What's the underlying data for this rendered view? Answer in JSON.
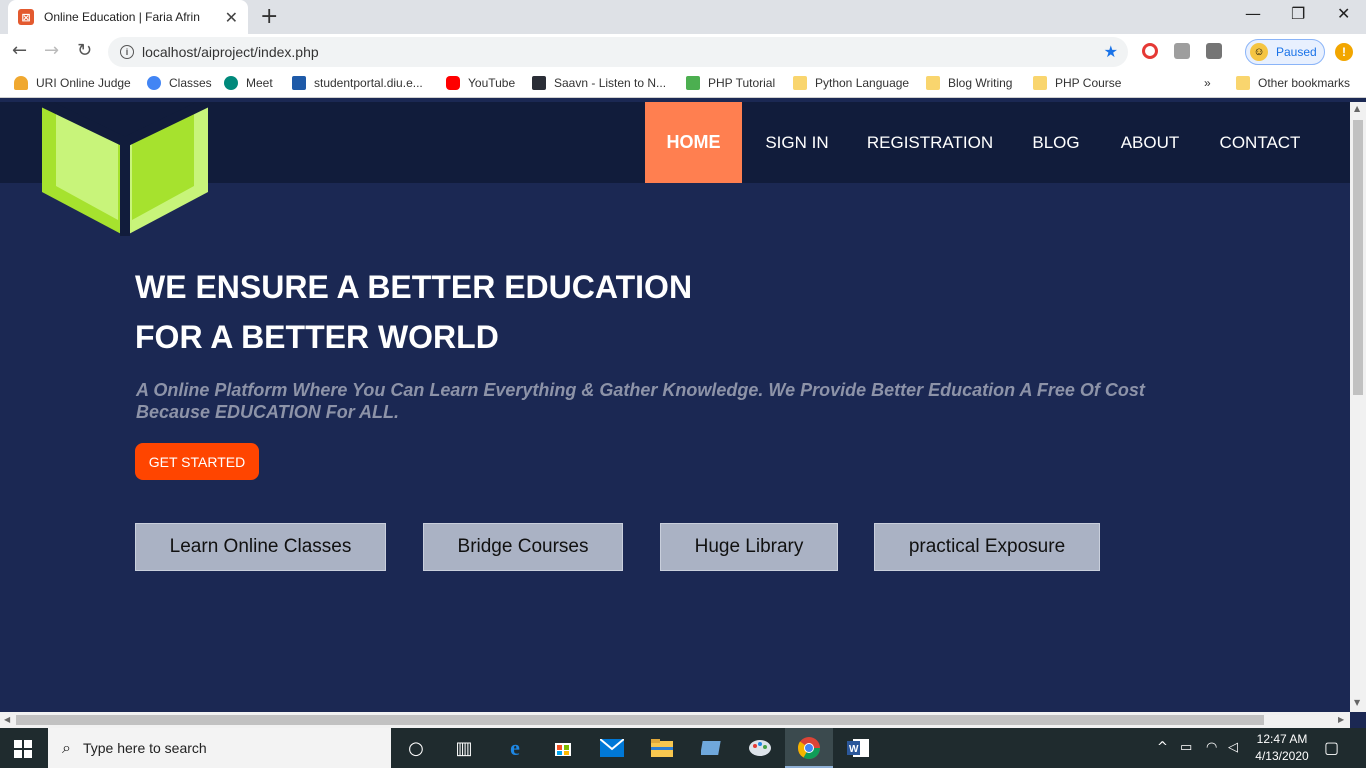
{
  "browser": {
    "tab_title": "Online Education | Faria Afrin",
    "tab_favicon_glyph": "⊠",
    "url_display": "localhost/aiproject/index.php",
    "profile_label": "Paused",
    "bookmarks": [
      {
        "label": "URI Online Judge",
        "icon": "trophy-icon"
      },
      {
        "label": "Classes",
        "icon": "google-icon"
      },
      {
        "label": "Meet",
        "icon": "meet-icon"
      },
      {
        "label": "studentportal.diu.e...",
        "icon": "diu-icon"
      },
      {
        "label": "YouTube",
        "icon": "youtube-icon"
      },
      {
        "label": "Saavn - Listen to N...",
        "icon": "saavn-icon"
      },
      {
        "label": "PHP Tutorial",
        "icon": "w3-icon"
      },
      {
        "label": "Python Language",
        "icon": "folder-icon"
      },
      {
        "label": "Blog Writing",
        "icon": "folder-icon"
      },
      {
        "label": "PHP Course",
        "icon": "folder-icon"
      }
    ],
    "bookmarks_overflow": "»",
    "other_bookmarks": "Other bookmarks"
  },
  "site": {
    "nav": [
      "HOME",
      "SIGN IN",
      "REGISTRATION",
      "BLOG",
      "ABOUT",
      "CONTACT"
    ],
    "active_nav": "HOME",
    "hero_line1": "WE ENSURE A BETTER EDUCATION",
    "hero_line2": "FOR A BETTER WORLD",
    "hero_sub_line1": "A Online Platform Where You Can Learn Everything & Gather Knowledge. We Provide Better Education A Free Of Cost",
    "hero_sub_line2": "Because EDUCATION For ALL.",
    "cta": "GET STARTED",
    "features": [
      "Learn Online Classes",
      "Bridge Courses",
      "Huge Library",
      "practical Exposure"
    ],
    "colors": {
      "bg": "#1b2853",
      "topbar": "#111c3b",
      "active_nav": "#ff7f50",
      "cta": "#ff4500",
      "logo_dark": "#a6e22e",
      "logo_light": "#c8f47a"
    }
  },
  "taskbar": {
    "search_placeholder": "Type here to search",
    "time": "12:47 AM",
    "date": "4/13/2020"
  }
}
